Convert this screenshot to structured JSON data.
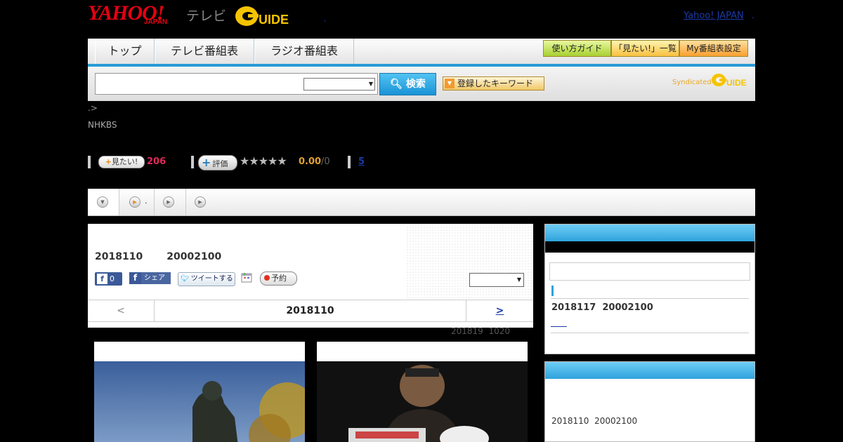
{
  "header": {
    "brand_yahoo": "YAHOO!",
    "brand_japan": "JAPAN",
    "brand_tv": "テレビ",
    "brand_gguide": "G GUIDE",
    "yahoo_japan_link": "Yahoo! JAPAN",
    "dot_link": ".",
    "small_dot": ","
  },
  "nav": {
    "tabs": [
      {
        "label": "トップ"
      },
      {
        "label": "テレビ番組表"
      },
      {
        "label": "ラジオ番組表"
      }
    ],
    "buttons": [
      {
        "label": "使い方ガイド",
        "color": "#b8e048"
      },
      {
        "label": "「見たい!」一覧",
        "color": "#ffd060"
      },
      {
        "label": "My番組表設定",
        "color": "#ffb040"
      }
    ]
  },
  "search": {
    "input_value": "",
    "select_value": "",
    "button_label": "検索",
    "keyword_button_label": "登録したキーワード",
    "syndicated_label": "Syndicated",
    "syndicated_brand": "G GUIDE"
  },
  "breadcrumb": ".>",
  "channel": "NHKBS",
  "ratings": {
    "mitai_label": "見たい!",
    "mitai_count": "206",
    "hyoka_label": "評価",
    "stars": "★★★★★",
    "score": "0.00",
    "score_sub": "/0",
    "review_link": "5"
  },
  "subtabs": [
    {
      "label": ""
    },
    {
      "label": "."
    },
    {
      "label": ""
    },
    {
      "label": ""
    }
  ],
  "program": {
    "date_time": "2018110       20002100",
    "fb_like_count": "0",
    "fb_share_label": "シェア",
    "tweet_label": "ツイートする",
    "yoyaku_label": "予約",
    "select_value": ""
  },
  "date_nav": {
    "prev": "<",
    "current": "2018110",
    "next": ">"
  },
  "update_info": "201819  1020",
  "sidebar": {
    "next_broadcast": "2018117  20002100",
    "more_link": "      ",
    "second_time": "2018110  20002100"
  },
  "colors": {
    "accent_blue": "#2a9bd6",
    "brand_red": "#e60012",
    "gguide_yellow": "#f5c400",
    "count_red": "#e0285a",
    "score_orange": "#e0a030"
  }
}
